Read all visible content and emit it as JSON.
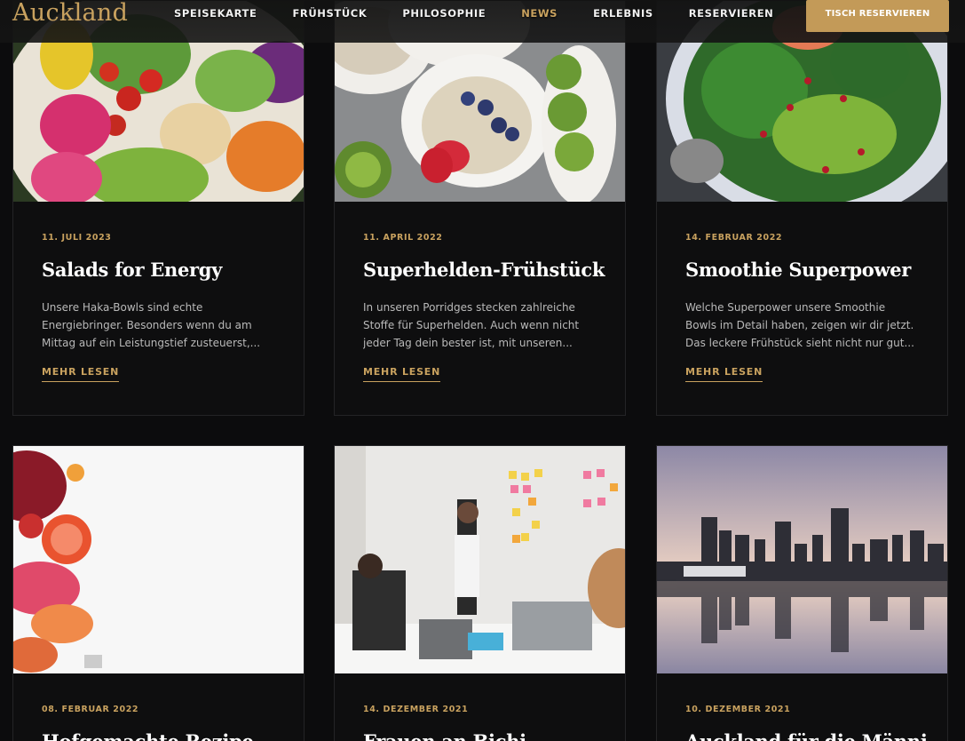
{
  "header": {
    "logo": "Auckland",
    "nav": [
      "SPEISEKARTE",
      "FRÜHSTÜCK",
      "PHILOSOPHIE",
      "NEWS",
      "ERLEBNIS",
      "RESERVIEREN"
    ],
    "active_nav": "NEWS",
    "cta": "TISCH RESERVIEREN"
  },
  "colors": {
    "accent": "#c9a25f",
    "background": "#0c0c0d",
    "card_border": "#242426"
  },
  "posts": [
    {
      "date": "11. JULI 2023",
      "title": "Salads for Energy",
      "excerpt": "Unsere Haka-Bowls sind echte Energiebringer. Besonders wenn du am Mittag auf ein Leistungstief zusteuerst,...",
      "more": "MEHR LESEN"
    },
    {
      "date": "11. APRIL 2022",
      "title": "Superhelden-Frühstück",
      "excerpt": "In unseren Porridges stecken zahlreiche Stoffe für Superhelden. Auch wenn nicht jeder Tag dein bester ist, mit unseren...",
      "more": "MEHR LESEN"
    },
    {
      "date": "14. FEBRUAR 2022",
      "title": "Smoothie Superpower",
      "excerpt": "Welche Superpower unsere Smoothie Bowls im Detail haben, zeigen wir dir jetzt. Das leckere Frühstück sieht nicht nur gut...",
      "more": "MEHR LESEN"
    },
    {
      "date": "08. FEBRUAR 2022",
      "title": "Hofgemachte Rezipe"
    },
    {
      "date": "14. DEZEMBER 2021",
      "title": "Frauen an Bichi"
    },
    {
      "date": "10. DEZEMBER 2021",
      "title": "Auckland für die Männi"
    }
  ]
}
